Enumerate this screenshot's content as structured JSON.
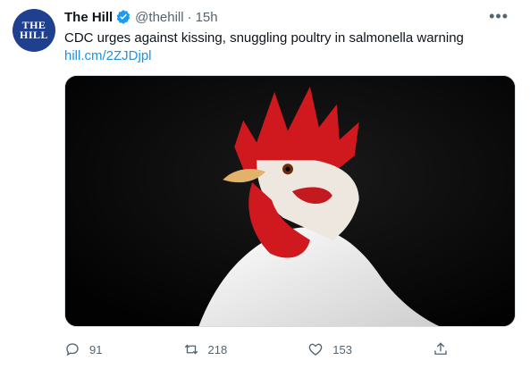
{
  "account": {
    "avatar_line1": "THE",
    "avatar_line2": "HILL",
    "name": "The Hill",
    "handle": "@thehill",
    "separator": "·",
    "time": "15h",
    "verified": true
  },
  "tweet": {
    "text": "CDC urges against kissing, snuggling poultry in salmonella warning",
    "link": "hill.cm/2ZJDjpl",
    "media_description": ""
  },
  "actions": {
    "reply_count": "91",
    "retweet_count": "218",
    "like_count": "153"
  },
  "colors": {
    "accent": "#1b95e0",
    "avatar_bg": "#1f3f8f",
    "muted_text": "#536471"
  },
  "icons": [
    "verified-badge-icon",
    "more-icon",
    "reply-icon",
    "retweet-icon",
    "like-icon",
    "share-icon"
  ]
}
